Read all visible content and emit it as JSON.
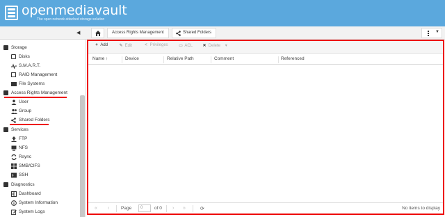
{
  "brand": {
    "title": "openmediavault",
    "subtitle": "The open network attached storage solution",
    "header_color": "#5ba8dd"
  },
  "navbar": {
    "collapse_icon": "chevron-left-icon",
    "home_icon": "home-icon",
    "breadcrumbs": [
      "Access Rights Management",
      "Shared Folders"
    ],
    "menu_icon": "kebab-menu-icon"
  },
  "sidebar": {
    "sections": [
      {
        "label": "Storage",
        "items": [
          "Disks",
          "S.M.A.R.T.",
          "RAID Management",
          "File Systems"
        ]
      },
      {
        "label": "Access Rights Management",
        "items": [
          "User",
          "Group",
          "Shared Folders"
        ]
      },
      {
        "label": "Services",
        "items": [
          "FTP",
          "NFS",
          "Rsync",
          "SMB/CIFS",
          "SSH"
        ]
      },
      {
        "label": "Diagnostics",
        "items": [
          "Dashboard",
          "System Information",
          "System Logs"
        ]
      }
    ]
  },
  "toolbar": {
    "add": "Add",
    "edit": "Edit",
    "privileges": "Privileges",
    "acl": "ACL",
    "delete": "Delete"
  },
  "grid": {
    "columns": [
      "Name",
      "Device",
      "Relative Path",
      "Comment",
      "Referenced"
    ],
    "sort_indicator": "↑",
    "rows": []
  },
  "pager": {
    "page_label": "Page",
    "page_value": "0",
    "of_label": "of 0",
    "status": "No items to display"
  },
  "highlight_color": "#e00000"
}
